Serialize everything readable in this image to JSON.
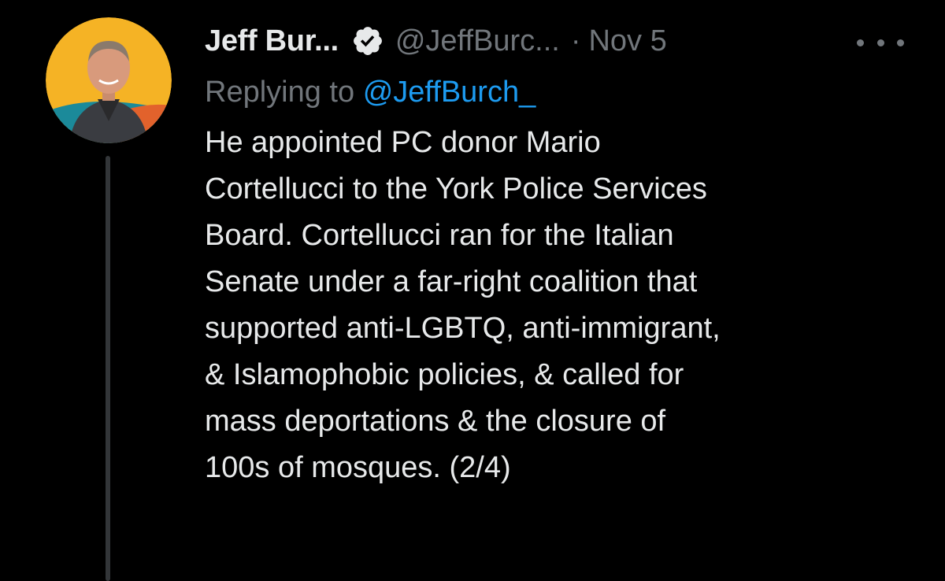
{
  "tweet": {
    "display_name": "Jeff Bur...",
    "handle": "@JeffBurc...",
    "separator": "·",
    "date": "Nov 5",
    "reply_prefix": "Replying to",
    "reply_mention": "@JeffBurch_",
    "body_lines": [
      "He appointed PC donor Mario",
      "Cortellucci to the York Police Services",
      "Board. Cortellucci ran for the Italian",
      "Senate under a far-right coalition that",
      "supported anti-LGBTQ, anti-immigrant,",
      "& Islamophobic policies, & called for",
      "mass deportations & the closure of",
      "100s of mosques. (2/4)"
    ]
  },
  "icons": {
    "verified": "verified-badge-icon",
    "more": "more-options-icon"
  },
  "colors": {
    "background": "#000000",
    "text_primary": "#e7e9ea",
    "text_secondary": "#71767b",
    "link": "#1d9bf0",
    "thread_line": "#333639",
    "avatar_bg": "#f5b325"
  }
}
